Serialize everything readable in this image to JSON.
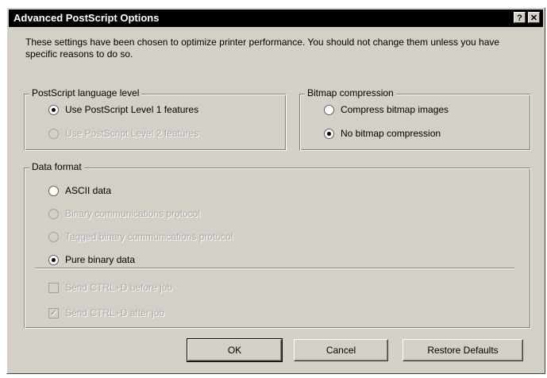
{
  "window": {
    "title": "Advanced PostScript Options",
    "help_button": "?",
    "close_button": "✕"
  },
  "intro_text": "These settings have been chosen to optimize printer performance. You should not change them unless you have specific reasons to do so.",
  "postscript_level": {
    "legend": "PostScript language level",
    "options": [
      {
        "label": "Use PostScript Level 1 features",
        "selected": true,
        "enabled": true
      },
      {
        "label": "Use PostScript Level 2 features",
        "selected": false,
        "enabled": false
      }
    ]
  },
  "bitmap_compression": {
    "legend": "Bitmap compression",
    "options": [
      {
        "label": "Compress bitmap images",
        "selected": false,
        "enabled": true
      },
      {
        "label": "No bitmap compression",
        "selected": true,
        "enabled": true
      }
    ]
  },
  "data_format": {
    "legend": "Data format",
    "options": [
      {
        "label": "ASCII data",
        "selected": false,
        "enabled": true
      },
      {
        "label": "Binary communications protocol",
        "selected": false,
        "enabled": false
      },
      {
        "label": "Tagged binary communications protocol",
        "selected": false,
        "enabled": false
      },
      {
        "label": "Pure binary data",
        "selected": true,
        "enabled": true
      }
    ],
    "checkboxes": [
      {
        "label": "Send CTRL+D before job",
        "checked": false,
        "enabled": false
      },
      {
        "label": "Send CTRL+D after job",
        "checked": true,
        "enabled": false
      }
    ]
  },
  "buttons": {
    "ok": "OK",
    "cancel": "Cancel",
    "restore_defaults": "Restore Defaults"
  }
}
